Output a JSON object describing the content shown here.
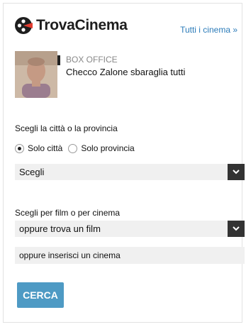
{
  "header": {
    "logo_text": "TrovaCinema",
    "all_cinemas_link": "Tutti i cinema »"
  },
  "news": {
    "kicker": "BOX OFFICE",
    "title": "Checco Zalone sbaraglia tutti"
  },
  "location": {
    "label": "Scegli la città o la provincia",
    "options": [
      {
        "label": "Solo città",
        "checked": true
      },
      {
        "label": "Solo provincia",
        "checked": false
      }
    ],
    "select_value": "Scegli"
  },
  "search": {
    "label": "Scegli per film o per cinema",
    "film_select_value": "oppure trova un film",
    "cinema_placeholder": "oppure inserisci un cinema",
    "button_label": "CERCA"
  },
  "icons": {
    "logo": "film-reel-icon",
    "dropdown": "chevron-down-icon"
  },
  "colors": {
    "accent": "#2b7bb9",
    "button": "#4e9ac4",
    "field_bg": "#f0f0f0",
    "dropdown_bg": "#333333"
  }
}
